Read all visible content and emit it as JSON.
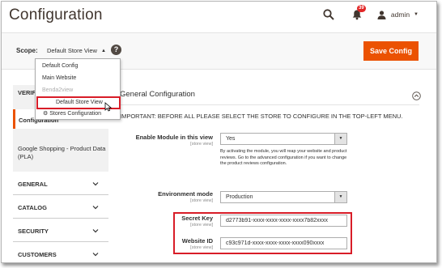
{
  "header": {
    "title": "Configuration",
    "notification_count": "39",
    "user_name": "admin"
  },
  "scope_bar": {
    "label": "Scope:",
    "selected": "Default Store View",
    "save_label": "Save Config"
  },
  "scope_dropdown": {
    "items": [
      {
        "label": "Default Config"
      },
      {
        "label": "Main Website"
      },
      {
        "label": "Benda2view"
      },
      {
        "label": "Default Store View"
      },
      {
        "label": "Stores Configuration"
      }
    ]
  },
  "sidebar": {
    "head_label": "VERIFI",
    "active_label": "Configuration",
    "sub_label": "Google Shopping - Product Data (PLA)",
    "sections": [
      {
        "label": "GENERAL"
      },
      {
        "label": "CATALOG"
      },
      {
        "label": "SECURITY"
      },
      {
        "label": "CUSTOMERS"
      }
    ]
  },
  "content": {
    "section_title": "General Configuration",
    "notice": "IMPORTANT: BEFORE ALL PLEASE SELECT THE STORE TO CONFIGURE IN THE TOP-LEFT MENU.",
    "fields": {
      "enable_module": {
        "label": "Enable Module in this view",
        "scope": "[store view]",
        "value": "Yes",
        "note": "By activating the module, you will reap your website and product reviews. Go to the advanced configuration if you want to change the product reviews configuration."
      },
      "environment_mode": {
        "label": "Environment mode",
        "scope": "[store view]",
        "value": "Production"
      },
      "secret_key": {
        "label": "Secret Key",
        "scope": "[store view]",
        "value": "d2773b91-xxxx-xxxx-xxxx-xxxx7b82xxxx"
      },
      "website_id": {
        "label": "Website ID",
        "scope": "[store view]",
        "value": "c93c971d-xxxx-xxxx-xxxx-xxxx090xxxx"
      }
    }
  },
  "colors": {
    "accent": "#eb5202",
    "highlight": "#d81d28",
    "badge": "#e22626"
  }
}
